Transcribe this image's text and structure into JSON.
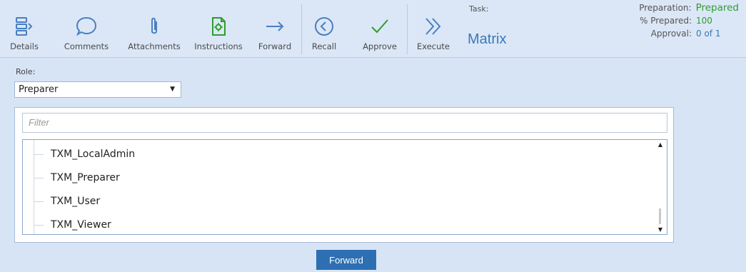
{
  "toolbar": {
    "buttons": [
      {
        "label": "Details",
        "icon": "details-icon"
      },
      {
        "label": "Comments",
        "icon": "speech-bubble-icon"
      },
      {
        "label": "Attachments",
        "icon": "paperclip-icon"
      },
      {
        "label": "Instructions",
        "icon": "document-gear-icon"
      },
      {
        "label": "Forward",
        "icon": "arrow-right-icon"
      },
      {
        "label": "Recall",
        "icon": "circle-chevron-left-icon"
      },
      {
        "label": "Approve",
        "icon": "checkmark-icon"
      },
      {
        "label": "Execute",
        "icon": "double-chevron-right-icon"
      }
    ],
    "icon_color": "#4a7fc1",
    "accent_green": "#2f9c2f"
  },
  "task": {
    "label": "Task:",
    "name": "Matrix"
  },
  "status": {
    "preparation_label": "Preparation:",
    "preparation_value": "Prepared",
    "percent_label": "% Prepared:",
    "percent_value": "100",
    "approval_label": "Approval:",
    "approval_value": "0 of 1"
  },
  "role": {
    "label": "Role:",
    "selected": "Preparer"
  },
  "filter": {
    "placeholder": "Filter"
  },
  "tree": {
    "items": [
      "TXM_LocalAdmin",
      "TXM_Preparer",
      "TXM_User",
      "TXM_Viewer"
    ]
  },
  "footer": {
    "forward_label": "Forward"
  }
}
